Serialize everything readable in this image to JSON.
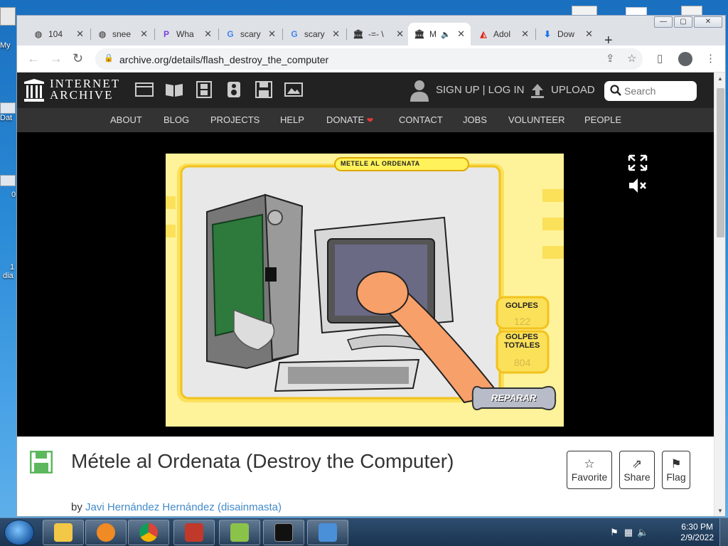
{
  "desktop": {
    "icon_labels": [
      "My",
      "Dat",
      "0",
      "1",
      "dia"
    ]
  },
  "browser": {
    "tabs": [
      {
        "title": "104",
        "icon": "globe-icon"
      },
      {
        "title": "snee",
        "icon": "globe-icon"
      },
      {
        "title": "Wha",
        "icon": "p-icon"
      },
      {
        "title": "scary",
        "icon": "google-icon"
      },
      {
        "title": "scary",
        "icon": "google-icon"
      },
      {
        "title": "-=- \\",
        "icon": "archive-icon"
      },
      {
        "title": "M",
        "icon": "archive-icon",
        "active": true,
        "muted": true
      },
      {
        "title": "Adol",
        "icon": "adobe-icon"
      },
      {
        "title": "Dow",
        "icon": "download-icon"
      }
    ],
    "url": "archive.org/details/flash_destroy_the_computer"
  },
  "archive": {
    "logo_line1": "INTERNET",
    "logo_line2": "ARCHIVE",
    "signup_label": "SIGN UP | LOG IN",
    "upload_label": "UPLOAD",
    "search_placeholder": "Search",
    "nav": [
      "ABOUT",
      "BLOG",
      "PROJECTS",
      "HELP",
      "DONATE",
      "CONTACT",
      "JOBS",
      "VOLUNTEER",
      "PEOPLE"
    ]
  },
  "game": {
    "banner": "METELE AL ORDENATA",
    "golpes_label": "GOLPES",
    "golpes_value": "122",
    "totales_label1": "GOLPES",
    "totales_label2": "TOTALES",
    "totales_value": "804",
    "repair_label": "REPARAR"
  },
  "item": {
    "title": "Métele al Ordenata (Destroy the Computer)",
    "by_prefix": "by",
    "author": "Javi Hernández Hernández (disainmasta)",
    "actions": {
      "favorite": "Favorite",
      "share": "Share",
      "flag": "Flag"
    }
  },
  "taskbar": {
    "time": "6:30 PM",
    "date": "2/9/2022"
  }
}
